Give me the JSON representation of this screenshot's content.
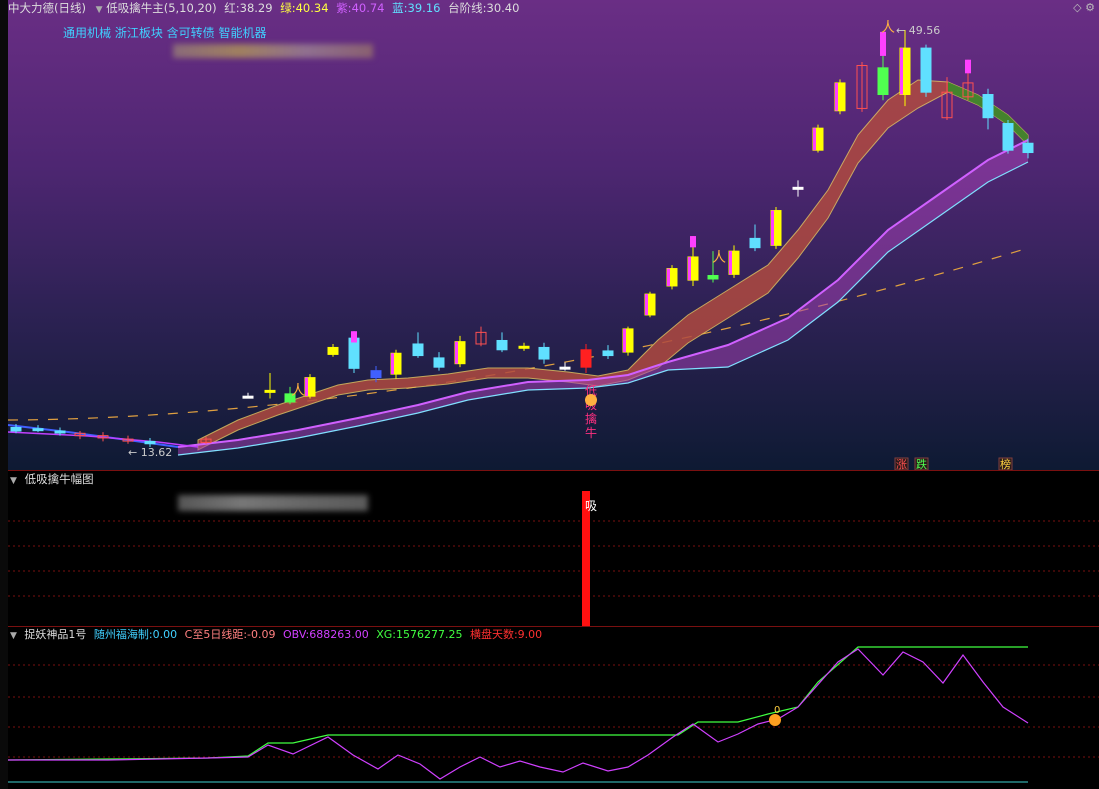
{
  "main": {
    "stock_name": "中大力德(日线)",
    "indicator_name": "低吸擒牛主(5,10,20)",
    "red_label": "红:",
    "red_value": "38.29",
    "green_label": "绿:",
    "green_value": "40.34",
    "purple_label": "紫:",
    "purple_value": "40.74",
    "blue_label": "蓝:",
    "blue_value": "39.16",
    "step_label": "台阶线:",
    "step_value": "30.40",
    "concepts": "通用机械 浙江板块 含可转债 智能机器",
    "high_label": "49.56",
    "low_label": "13.62",
    "signal_chars": [
      "低",
      "吸",
      "擒",
      "牛"
    ],
    "tags": [
      "涨",
      "跌",
      "榜"
    ],
    "colors": {
      "red": "#ff5050",
      "green": "#50ff50",
      "purple": "#d060ff",
      "blue": "#60e0ff",
      "yellow": "#ffff00"
    }
  },
  "mid": {
    "title": "低吸擒牛幅图",
    "signal_text": "吸"
  },
  "low": {
    "title": "捉妖神品1号",
    "l1_label": "随州福海制:",
    "l1_value": "0.00",
    "l2_label": "C至5日线距:",
    "l2_value": "-0.09",
    "l3_label": "OBV:",
    "l3_value": "688263.00",
    "l4_label": "XG:",
    "l4_value": "1576277.25",
    "l5_label": "横盘天数:",
    "l5_value": "9.00",
    "marker": "0"
  },
  "chart_data": {
    "type": "candlestick",
    "price_high": 49.56,
    "price_low": 13.62,
    "step_line": 30.4
  }
}
